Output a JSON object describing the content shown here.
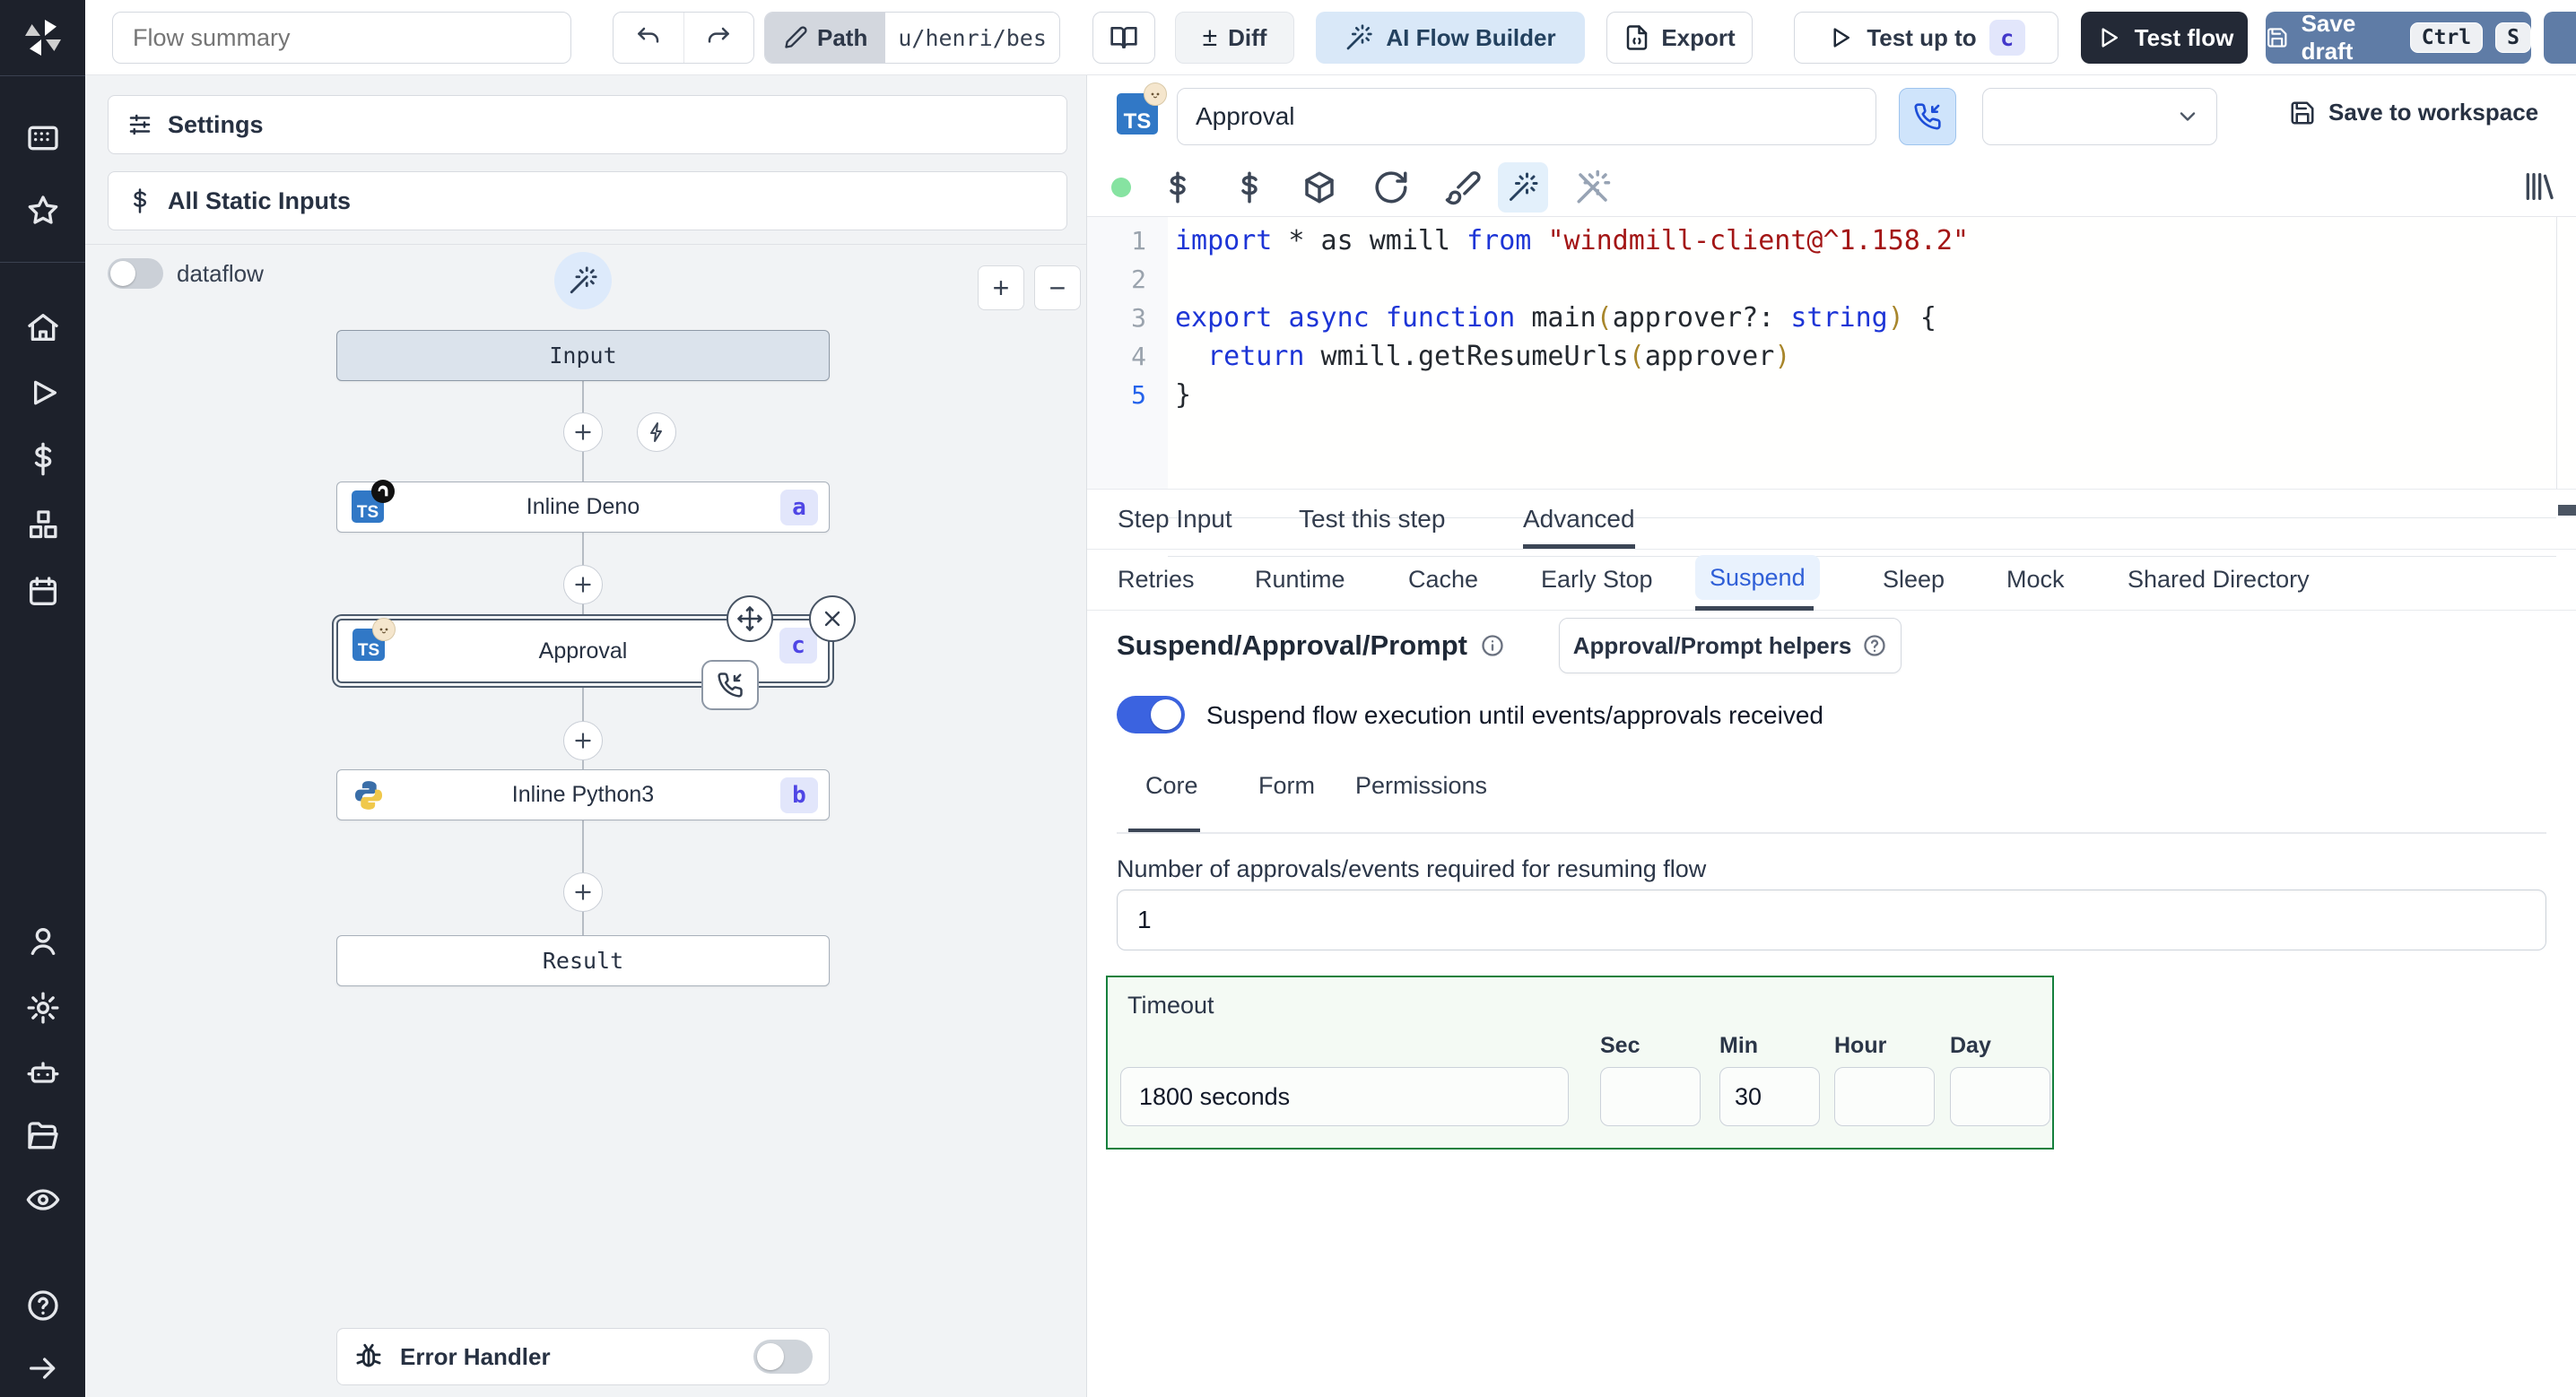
{
  "colors": {
    "rail_bg": "#1d212b",
    "accent_blue": "#3b63e0",
    "steel_blue_button": "#5f7ca6",
    "dark_button": "#232936",
    "ai_button_bg": "#d9e8f8",
    "badge_bg": "#e2e6fb",
    "badge_text": "#4f46e5",
    "timeout_border": "#15803d",
    "suspend_tab_active": "#2f5fd7",
    "code_keyword": "#1d35d6",
    "code_string": "#a31515",
    "toggle_on": "#3b63e0"
  },
  "topbar": {
    "flow_summary_placeholder": "Flow summary",
    "path_label": "Path",
    "path_value": "u/henri/bes",
    "diff_icon": "±",
    "diff_label": "Diff",
    "ai_flow_builder_label": "AI Flow Builder",
    "export_label": "Export",
    "test_up_to_label": "Test up to",
    "test_up_to_badge": "c",
    "test_flow_label": "Test flow",
    "save_draft_label": "Save draft",
    "save_draft_key_1": "Ctrl",
    "save_draft_key_2": "S"
  },
  "graph": {
    "settings_label": "Settings",
    "static_inputs_label": "All Static Inputs",
    "dataflow_label": "dataflow",
    "zoom_in_label": "+",
    "zoom_out_label": "−",
    "nodes": {
      "input": {
        "label": "Input"
      },
      "deno": {
        "label": "Inline Deno",
        "badge": "a",
        "lang": "TS"
      },
      "approval": {
        "label": "Approval",
        "badge": "c",
        "lang": "TS"
      },
      "python": {
        "label": "Inline Python3",
        "badge": "b"
      },
      "result": {
        "label": "Result"
      }
    },
    "error_handler_label": "Error Handler"
  },
  "step": {
    "lang_badge": "TS",
    "name_value": "Approval",
    "save_to_workspace_label": "Save to workspace"
  },
  "editor": {
    "code_lines": [
      [
        [
          "kw",
          "import"
        ],
        [
          "pl",
          " * as wmill "
        ],
        [
          "kw",
          "from"
        ],
        [
          "pl",
          " "
        ],
        [
          "str",
          "\"windmill-client@^1.158.2\""
        ]
      ],
      [],
      [
        [
          "kw",
          "export"
        ],
        [
          "pl",
          " "
        ],
        [
          "kw",
          "async"
        ],
        [
          "pl",
          " "
        ],
        [
          "kw",
          "function"
        ],
        [
          "pl",
          " "
        ],
        [
          "fn",
          "main"
        ],
        [
          "br",
          "("
        ],
        [
          "pl",
          "approver?: "
        ],
        [
          "kw",
          "string"
        ],
        [
          "br",
          ")"
        ],
        [
          "pl",
          " {"
        ]
      ],
      [
        [
          "pl",
          "  "
        ],
        [
          "kw",
          "return"
        ],
        [
          "pl",
          " wmill."
        ],
        [
          "fn",
          "getResumeUrls"
        ],
        [
          "br",
          "("
        ],
        [
          "pl",
          "approver"
        ],
        [
          "br",
          ")"
        ]
      ],
      [
        [
          "pl",
          "}"
        ]
      ]
    ]
  },
  "tabs": {
    "main": [
      "Step Input",
      "Test this step",
      "Advanced"
    ],
    "advanced": [
      "Retries",
      "Runtime",
      "Cache",
      "Early Stop",
      "Suspend",
      "Sleep",
      "Mock",
      "Shared Directory"
    ]
  },
  "suspend": {
    "title": "Suspend/Approval/Prompt",
    "helpers_label": "Approval/Prompt helpers",
    "toggle_label": "Suspend flow execution until events/approvals received",
    "sub_tabs": [
      "Core",
      "Form",
      "Permissions"
    ],
    "approvals_label": "Number of approvals/events required for resuming flow",
    "approvals_value": "1",
    "timeout_label": "Timeout",
    "timeout_value": "1800 seconds",
    "units": [
      {
        "label": "Sec",
        "value": ""
      },
      {
        "label": "Min",
        "value": "30"
      },
      {
        "label": "Hour",
        "value": ""
      },
      {
        "label": "Day",
        "value": ""
      }
    ]
  }
}
